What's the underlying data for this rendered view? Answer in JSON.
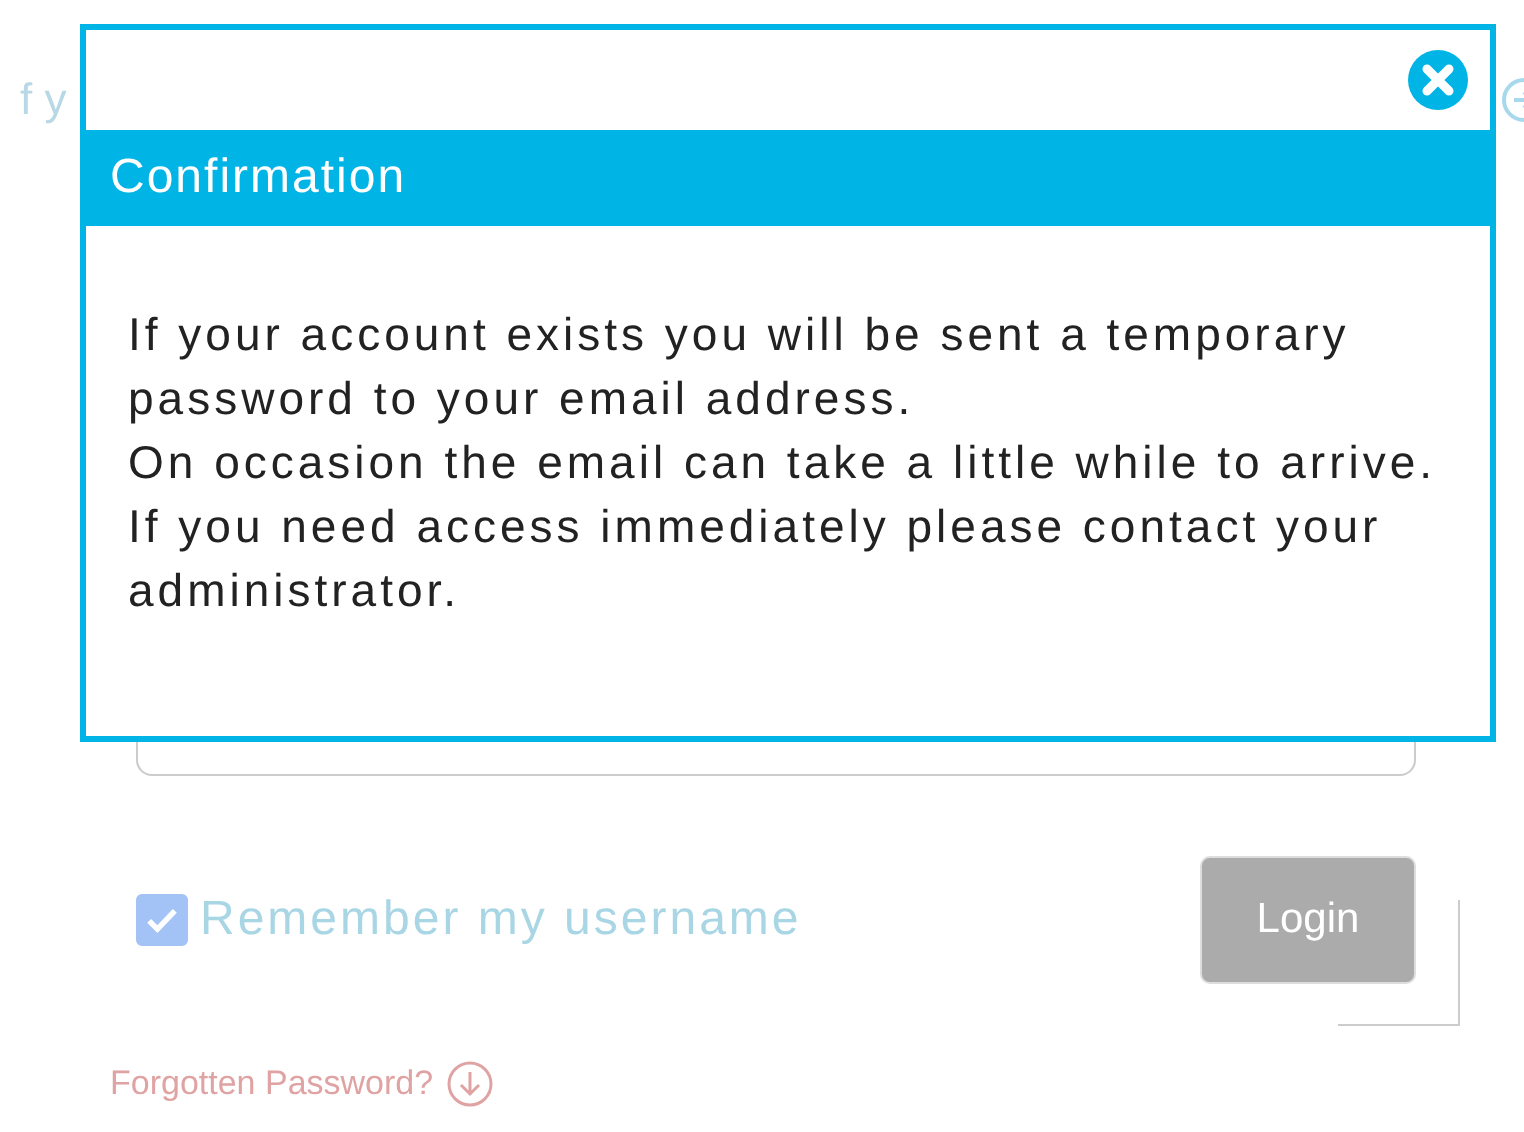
{
  "page": {
    "intro_fragment": "f y",
    "remember": {
      "label": "Remember my username",
      "checked": true
    },
    "login_button": "Login",
    "forgot_link": "Forgotten Password?"
  },
  "dialog": {
    "title": "Confirmation",
    "paragraphs": [
      "If your account exists you will be sent a temporary password to your email address.",
      "On occasion the email can take a little while to arrive.",
      "If you need access immediately please contact your administrator."
    ]
  }
}
